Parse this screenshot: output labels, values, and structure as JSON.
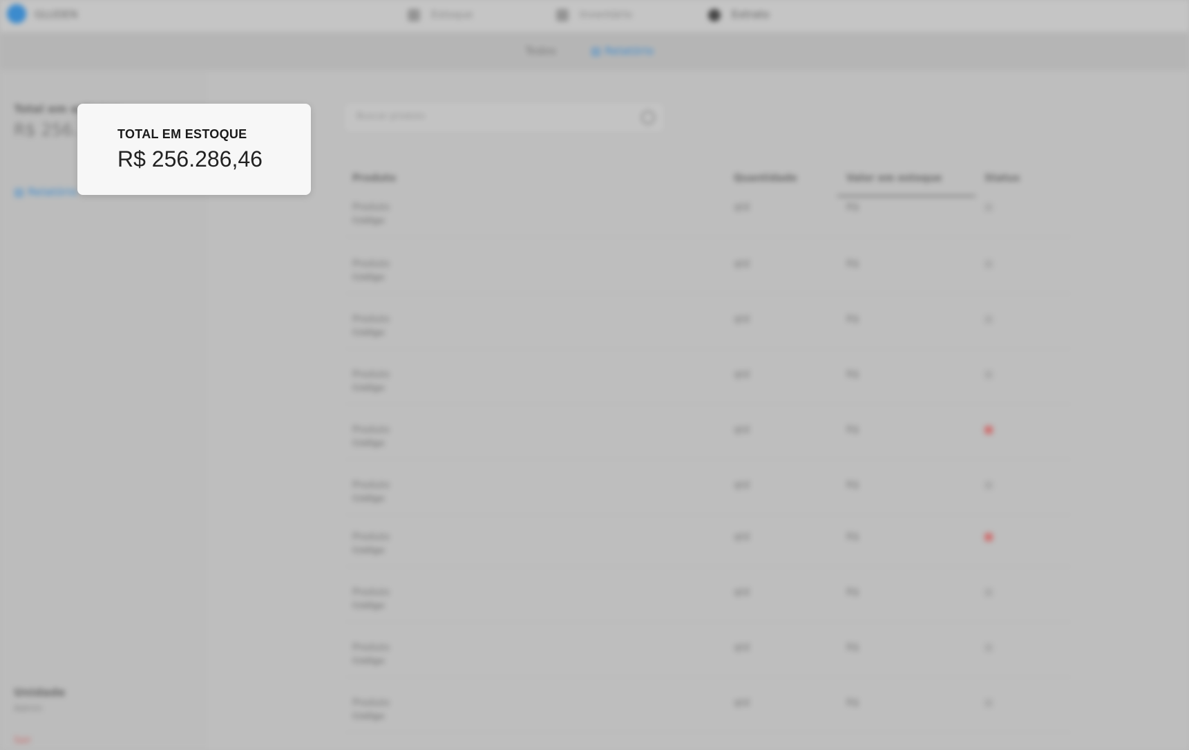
{
  "app": {
    "brand": "GLUDEN",
    "nav": [
      "Estoque",
      "Inventário",
      "Extrato"
    ],
    "subtabs": [
      "Todos",
      "Relatório"
    ]
  },
  "sidebar": {
    "total_label": "Total em estoque",
    "total_value": "R$ 256.",
    "report_link": "Relatório",
    "user_name": "Unidade",
    "user_role": "Admin",
    "exit_label": "Sair"
  },
  "search": {
    "placeholder": "Buscar produto"
  },
  "table": {
    "headers": [
      "Produto",
      "Quantidade",
      "Valor em estoque",
      "Status"
    ],
    "rows": [
      {
        "name": "Produto",
        "code": "Código",
        "qty": "qtd",
        "value": "R$",
        "status": "",
        "alert": false
      },
      {
        "name": "Produto",
        "code": "Código",
        "qty": "qtd",
        "value": "R$",
        "status": "",
        "alert": false
      },
      {
        "name": "Produto",
        "code": "Código",
        "qty": "qtd",
        "value": "R$",
        "status": "",
        "alert": false
      },
      {
        "name": "Produto",
        "code": "Código",
        "qty": "qtd",
        "value": "R$",
        "status": "",
        "alert": false
      },
      {
        "name": "Produto",
        "code": "Código",
        "qty": "qtd",
        "value": "R$",
        "status": "",
        "alert": true
      },
      {
        "name": "Produto",
        "code": "Código",
        "qty": "qtd",
        "value": "R$",
        "status": "",
        "alert": false
      },
      {
        "name": "Produto",
        "code": "Código",
        "qty": "qtd",
        "value": "R$",
        "status": "",
        "alert": true
      },
      {
        "name": "Produto",
        "code": "Código",
        "qty": "qtd",
        "value": "R$",
        "status": "",
        "alert": false
      },
      {
        "name": "Produto",
        "code": "Código",
        "qty": "qtd",
        "value": "R$",
        "status": "",
        "alert": false
      },
      {
        "name": "Produto",
        "code": "Código",
        "qty": "qtd",
        "value": "R$",
        "status": "",
        "alert": false
      }
    ]
  },
  "popup": {
    "label": "TOTAL EM ESTOQUE",
    "value": "R$ 256.286,46"
  },
  "colors": {
    "accent": "#2f8fe0",
    "alert": "#e07070",
    "popup_bg": "#f7f7f7"
  }
}
